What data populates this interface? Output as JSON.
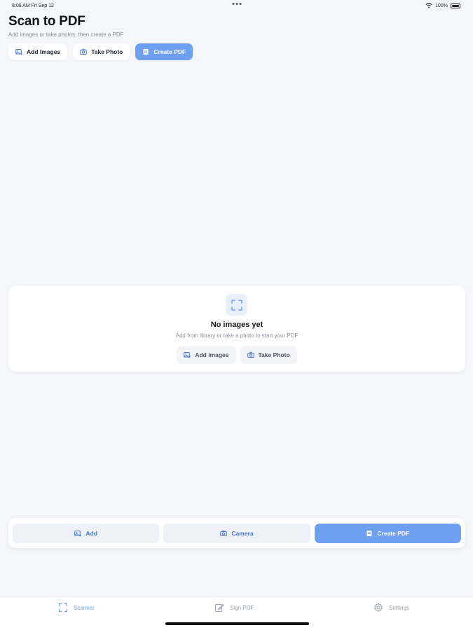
{
  "status_bar": {
    "time_date": "8:08 AM  Fri Sep 12",
    "battery": "100%"
  },
  "header": {
    "title": "Scan to PDF",
    "subtitle": "Add images or take photos, then create a PDF"
  },
  "top_actions": {
    "add_images": "Add Images",
    "take_photo": "Take Photo",
    "create_pdf": "Create PDF"
  },
  "empty_state": {
    "title": "No images yet",
    "description": "Add from library or take a photo to start your PDF",
    "add_images": "Add images",
    "take_photo": "Take Photo"
  },
  "bottom_bar": {
    "add": "Add",
    "camera": "Camera",
    "create_pdf": "Create PDF"
  },
  "tabs": [
    {
      "label": "Scanner",
      "icon": "scan-icon",
      "active": true
    },
    {
      "label": "Sign PDF",
      "icon": "edit-icon",
      "active": false
    },
    {
      "label": "Settings",
      "icon": "gear-icon",
      "active": false
    }
  ],
  "colors": {
    "accent": "#6f9ff0",
    "background": "#f4f6f9",
    "card": "#ffffff"
  }
}
